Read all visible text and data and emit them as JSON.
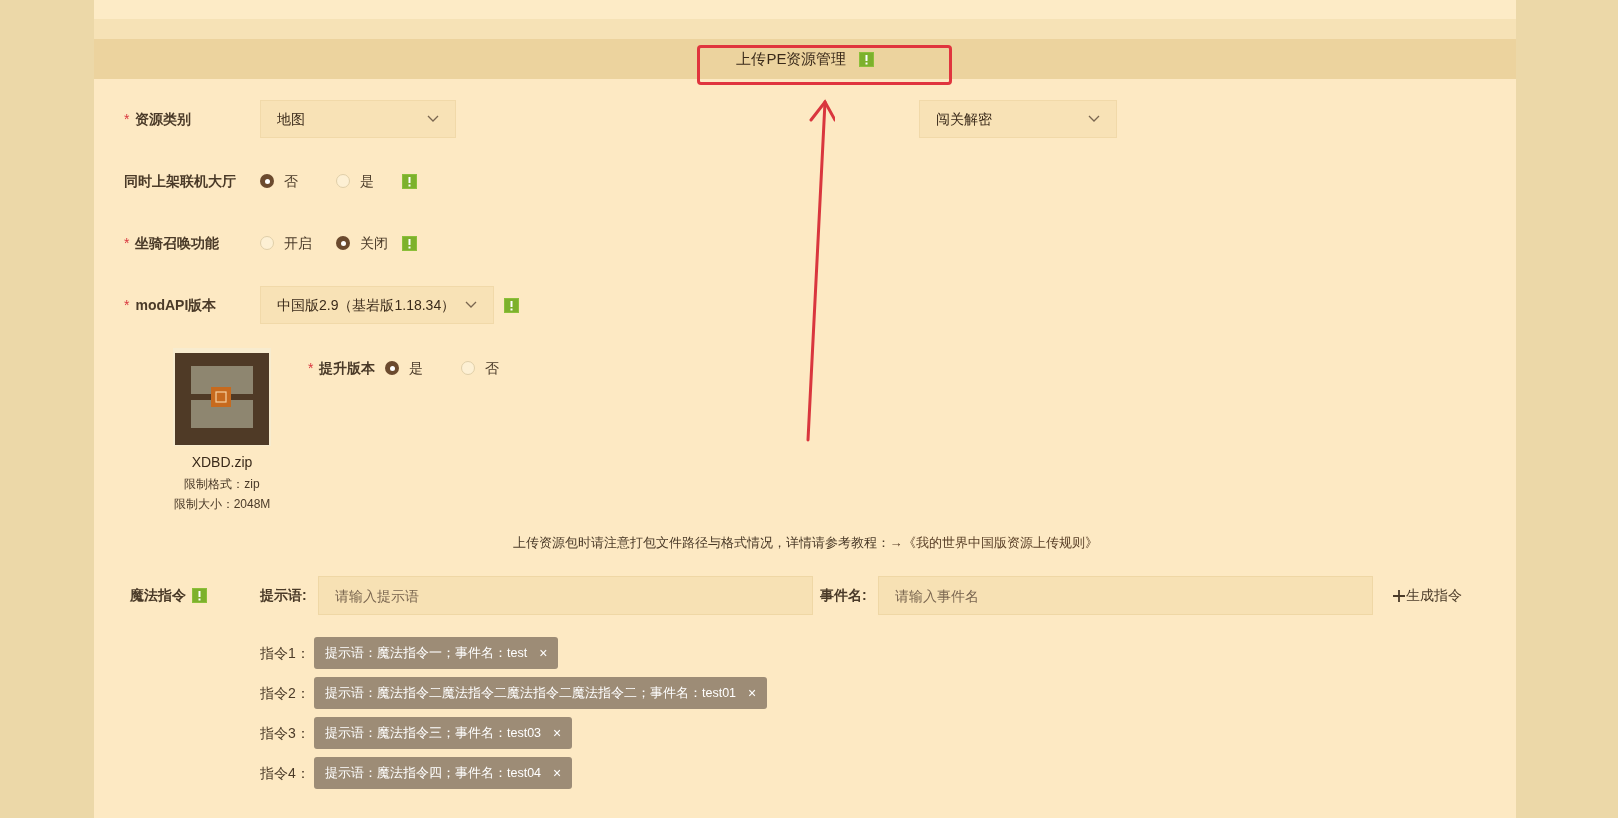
{
  "header": {
    "title": "上传PE资源管理",
    "info": true
  },
  "fields": [
    {
      "kind": "select_pair",
      "mark": "*",
      "label": "资源类别",
      "value": "地图",
      "value_2": "闯关解密"
    },
    {
      "kind": "radio",
      "label": "同时上架联机大厅",
      "info": true,
      "options": [
        {
          "label": "否",
          "selected": true
        },
        {
          "label": "是",
          "selected": false
        }
      ]
    },
    {
      "kind": "radio",
      "mark": "*",
      "label": "坐骑召唤功能",
      "info": true,
      "options": [
        {
          "label": "开启",
          "selected": false
        },
        {
          "label": "关闭",
          "selected": true
        }
      ]
    },
    {
      "kind": "select",
      "mark": "*",
      "label": "modAPI版本",
      "value": "中国版2.9（基岩版1.18.34）",
      "info": true
    }
  ],
  "upload": {
    "file_name": "XDBD.zip",
    "format": "限制格式：zip",
    "size": "限制大小：2048M",
    "upgrade": {
      "mark": "*",
      "label": "提升版本",
      "options": [
        {
          "label": "是",
          "selected": true
        },
        {
          "label": "否",
          "selected": false
        }
      ]
    }
  },
  "notice": {
    "text": "上传资源包时请注意打包文件路径与格式情况，详情请参考教程：",
    "link": "→《我的世界中国版资源上传规则》"
  },
  "magic": {
    "label": "魔法指令",
    "info": true,
    "prompt_label": "提示语:",
    "prompt_placeholder": "请输入提示语",
    "event_label": "事件名:",
    "event_placeholder": "请输入事件名",
    "generate": "生成指令",
    "commands": [
      {
        "label": "指令1：",
        "text": "提示语：魔法指令一；事件名：test",
        "close": "×"
      },
      {
        "label": "指令2：",
        "text": "提示语：魔法指令二魔法指令二魔法指令二魔法指令二；事件名：test01",
        "close": "×"
      },
      {
        "label": "指令3：",
        "text": "提示语：魔法指令三；事件名：test03",
        "close": "×"
      },
      {
        "label": "指令4：",
        "text": "提示语：魔法指令四；事件名：test04",
        "close": "×"
      }
    ]
  }
}
